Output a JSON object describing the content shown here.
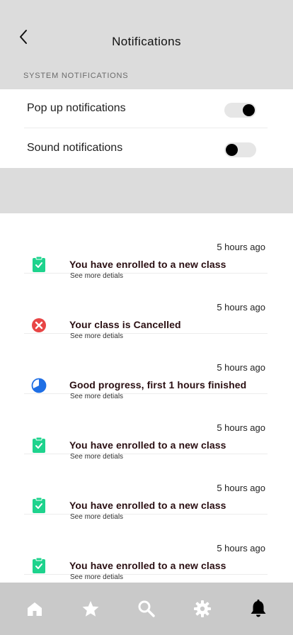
{
  "header": {
    "title": "Notifications"
  },
  "system": {
    "section_label": "SYSTEM NOTIFICATIONS",
    "settings": [
      {
        "label": "Pop up notifications",
        "state": "on"
      },
      {
        "label": "Sound notifications",
        "state": "off"
      }
    ]
  },
  "notifications": [
    {
      "time": "5 hours ago",
      "title": "You have enrolled to a new class",
      "details": "See more detials",
      "icon": "clipboard-check-icon"
    },
    {
      "time": "5 hours ago",
      "title": "Your class is Cancelled",
      "details": "See more detials",
      "icon": "cancel-circle-icon"
    },
    {
      "time": "5 hours ago",
      "title": "Good progress, first 1 hours finished",
      "details": "See more detials",
      "icon": "progress-pie-icon"
    },
    {
      "time": "5 hours ago",
      "title": "You have enrolled to a new class",
      "details": "See more detials",
      "icon": "clipboard-check-icon"
    },
    {
      "time": "5 hours ago",
      "title": "You have enrolled to a new class",
      "details": "See more detials",
      "icon": "clipboard-check-icon"
    },
    {
      "time": "5 hours ago",
      "title": "You have enrolled to a new class",
      "details": "See more detials",
      "icon": "clipboard-check-icon"
    }
  ],
  "tabbar": {
    "items": [
      "home-icon",
      "star-icon",
      "search-icon",
      "gear-icon",
      "bell-icon"
    ],
    "active": "bell-icon"
  },
  "colors": {
    "header_bg": "#dcdcdc",
    "tabbar_bg": "#c9c9c9",
    "success": "#1ed38d",
    "danger": "#e84545",
    "progress": "#1f6fe5"
  }
}
